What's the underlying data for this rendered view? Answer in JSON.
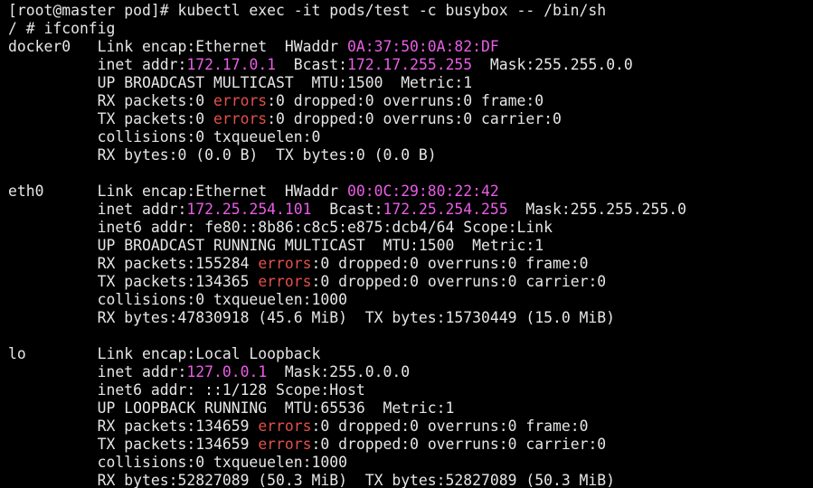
{
  "colors": {
    "background": "#000000",
    "text": "#e6e6e6",
    "address": "#e95de6",
    "errors": "#e2504a"
  },
  "terminal": {
    "lines": [
      [
        {
          "t": "[root@master pod]# kubectl exec -it pods/test -c busybox -- /bin/sh",
          "c": "n"
        }
      ],
      [
        {
          "t": "/ # ifconfig",
          "c": "n"
        }
      ],
      [
        {
          "t": "docker0   Link encap:Ethernet  HWaddr ",
          "c": "n"
        },
        {
          "t": "0A:37:50:0A:82:DF",
          "c": "m"
        }
      ],
      [
        {
          "t": "          inet addr:",
          "c": "n"
        },
        {
          "t": "172.17.0.1",
          "c": "m"
        },
        {
          "t": "  Bcast:",
          "c": "n"
        },
        {
          "t": "172.17.255.255",
          "c": "m"
        },
        {
          "t": "  Mask:255.255.0.0",
          "c": "n"
        }
      ],
      [
        {
          "t": "          UP BROADCAST MULTICAST  MTU:1500  Metric:1",
          "c": "n"
        }
      ],
      [
        {
          "t": "          RX packets:0 ",
          "c": "n"
        },
        {
          "t": "errors",
          "c": "r"
        },
        {
          "t": ":0 dropped:0 overruns:0 frame:0",
          "c": "n"
        }
      ],
      [
        {
          "t": "          TX packets:0 ",
          "c": "n"
        },
        {
          "t": "errors",
          "c": "r"
        },
        {
          "t": ":0 dropped:0 overruns:0 carrier:0",
          "c": "n"
        }
      ],
      [
        {
          "t": "          collisions:0 txqueuelen:0",
          "c": "n"
        }
      ],
      [
        {
          "t": "          RX bytes:0 (0.0 B)  TX bytes:0 (0.0 B)",
          "c": "n"
        }
      ],
      [
        {
          "t": "",
          "c": "n"
        }
      ],
      [
        {
          "t": "eth0      Link encap:Ethernet  HWaddr ",
          "c": "n"
        },
        {
          "t": "00:0C:29:80:22:42",
          "c": "m"
        }
      ],
      [
        {
          "t": "          inet addr:",
          "c": "n"
        },
        {
          "t": "172.25.254.101",
          "c": "m"
        },
        {
          "t": "  Bcast:",
          "c": "n"
        },
        {
          "t": "172.25.254.255",
          "c": "m"
        },
        {
          "t": "  Mask:255.255.255.0",
          "c": "n"
        }
      ],
      [
        {
          "t": "          inet6 addr: fe80::8b86:c8c5:e875:dcb4/64 Scope:Link",
          "c": "n"
        }
      ],
      [
        {
          "t": "          UP BROADCAST RUNNING MULTICAST  MTU:1500  Metric:1",
          "c": "n"
        }
      ],
      [
        {
          "t": "          RX packets:155284 ",
          "c": "n"
        },
        {
          "t": "errors",
          "c": "r"
        },
        {
          "t": ":0 dropped:0 overruns:0 frame:0",
          "c": "n"
        }
      ],
      [
        {
          "t": "          TX packets:134365 ",
          "c": "n"
        },
        {
          "t": "errors",
          "c": "r"
        },
        {
          "t": ":0 dropped:0 overruns:0 carrier:0",
          "c": "n"
        }
      ],
      [
        {
          "t": "          collisions:0 txqueuelen:1000",
          "c": "n"
        }
      ],
      [
        {
          "t": "          RX bytes:47830918 (45.6 MiB)  TX bytes:15730449 (15.0 MiB)",
          "c": "n"
        }
      ],
      [
        {
          "t": "",
          "c": "n"
        }
      ],
      [
        {
          "t": "lo        Link encap:Local Loopback",
          "c": "n"
        }
      ],
      [
        {
          "t": "          inet addr:",
          "c": "n"
        },
        {
          "t": "127.0.0.1",
          "c": "m"
        },
        {
          "t": "  Mask:255.0.0.0",
          "c": "n"
        }
      ],
      [
        {
          "t": "          inet6 addr: ::1/128 Scope:Host",
          "c": "n"
        }
      ],
      [
        {
          "t": "          UP LOOPBACK RUNNING  MTU:65536  Metric:1",
          "c": "n"
        }
      ],
      [
        {
          "t": "          RX packets:134659 ",
          "c": "n"
        },
        {
          "t": "errors",
          "c": "r"
        },
        {
          "t": ":0 dropped:0 overruns:0 frame:0",
          "c": "n"
        }
      ],
      [
        {
          "t": "          TX packets:134659 ",
          "c": "n"
        },
        {
          "t": "errors",
          "c": "r"
        },
        {
          "t": ":0 dropped:0 overruns:0 carrier:0",
          "c": "n"
        }
      ],
      [
        {
          "t": "          collisions:0 txqueuelen:1000",
          "c": "n"
        }
      ],
      [
        {
          "t": "          RX bytes:52827089 (50.3 MiB)  TX bytes:52827089 (50.3 MiB)",
          "c": "n"
        }
      ]
    ]
  }
}
